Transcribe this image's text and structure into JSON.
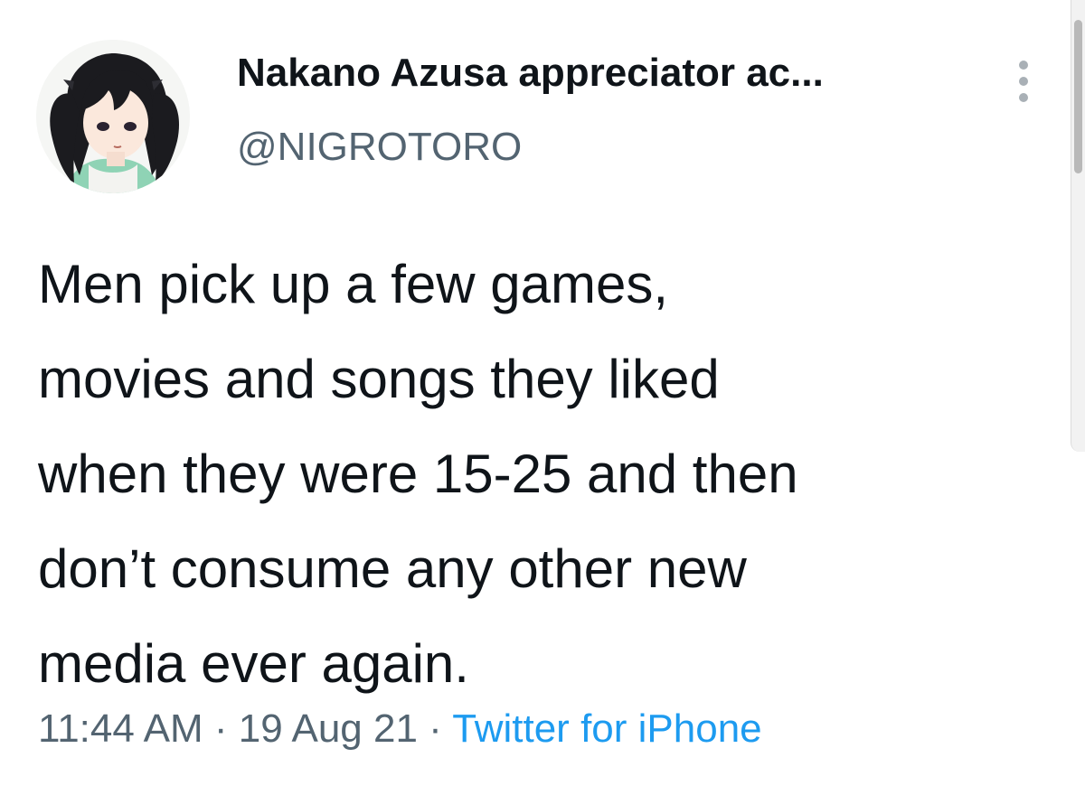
{
  "tweet": {
    "author": {
      "display_name": "Nakano Azusa appreciator ac...",
      "handle": "@NIGROTORO",
      "avatar_icon": "anime-girl-avatar-icon"
    },
    "more_icon": "vertical-ellipsis-icon",
    "text_lines": [
      "Men pick up a few games,",
      "movies and songs they liked",
      "when they were 15-25 and then",
      "don’t consume any other new",
      "media ever again."
    ],
    "meta": {
      "time": "11:44 AM",
      "separator": " · ",
      "date": "19 Aug 21",
      "source": "Twitter for iPhone"
    },
    "colors": {
      "text": "#0f1419",
      "secondary": "#536471",
      "link": "#1d9bf0"
    }
  }
}
